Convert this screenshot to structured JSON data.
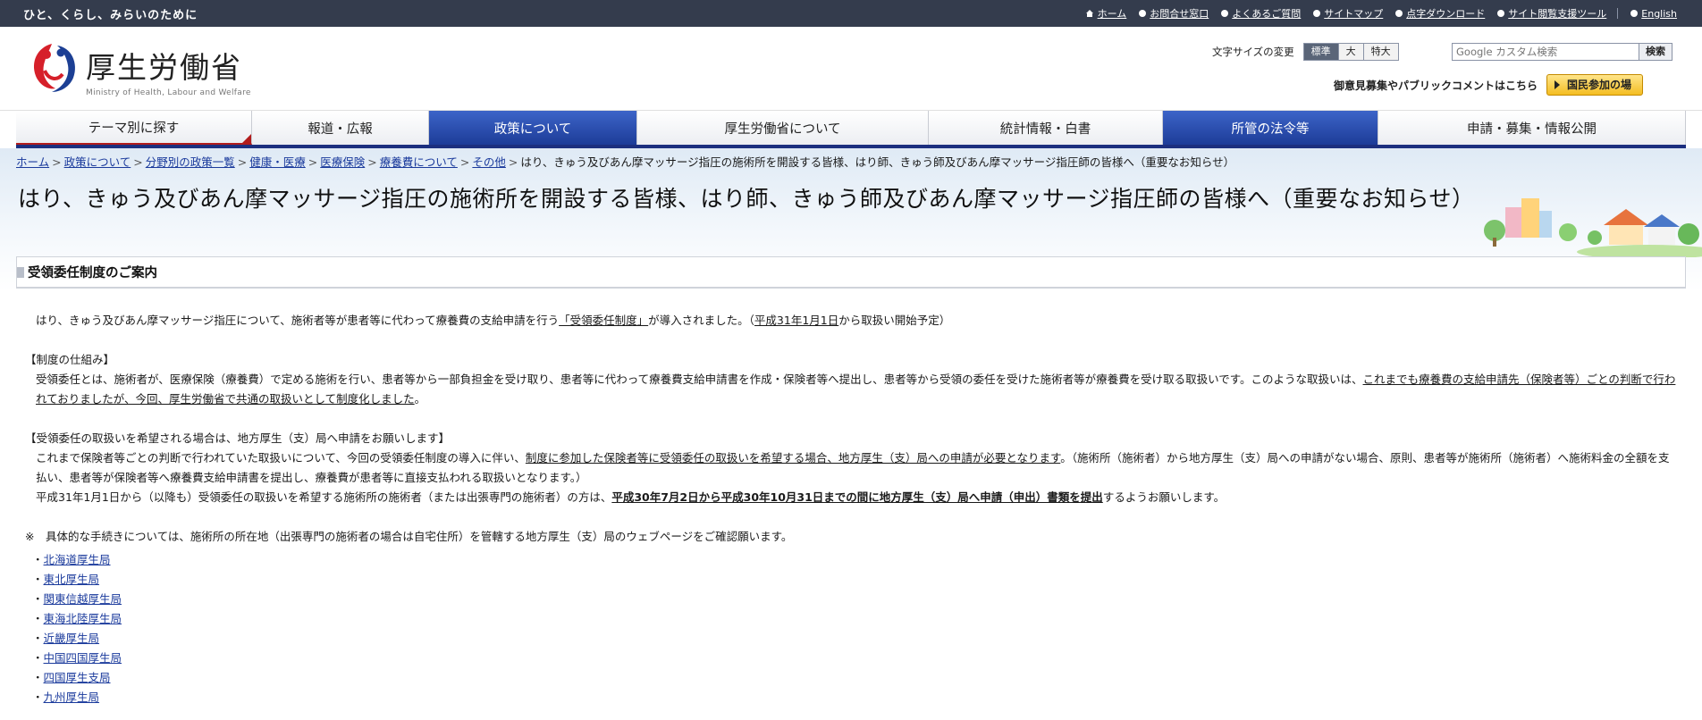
{
  "topbar": {
    "tagline": "ひと、くらし、みらいのために",
    "links": [
      {
        "label": "ホーム",
        "icon": "home-icon"
      },
      {
        "label": "お問合せ窓口",
        "icon": "circle-icon"
      },
      {
        "label": "よくあるご質問",
        "icon": "circle-icon"
      },
      {
        "label": "サイトマップ",
        "icon": "circle-icon"
      },
      {
        "label": "点字ダウンロード",
        "icon": "circle-icon"
      },
      {
        "label": "サイト閲覧支援ツール",
        "icon": "circle-icon"
      },
      {
        "label": "English",
        "icon": "circle-icon"
      }
    ]
  },
  "header": {
    "logo_jp": "厚生労働省",
    "logo_en": "Ministry of Health, Labour and Welfare",
    "fontsize_label": "文字サイズの変更",
    "fontsize_options": [
      "標準",
      "大",
      "特大"
    ],
    "search_placeholder": "Google カスタム検索",
    "search_button": "検索",
    "public_comment": "御意見募集やパブリックコメントはこちら",
    "public_button": "国民参加の場"
  },
  "nav": {
    "items": [
      {
        "label": "テーマ別に探す",
        "active": false
      },
      {
        "label": "報道・広報",
        "active": false
      },
      {
        "label": "政策について",
        "active": true
      },
      {
        "label": "厚生労働省について",
        "active": false
      },
      {
        "label": "統計情報・白書",
        "active": false
      },
      {
        "label": "所管の法令等",
        "active": true
      },
      {
        "label": "申請・募集・情報公開",
        "active": false
      }
    ]
  },
  "breadcrumb": {
    "items": [
      "ホーム",
      "政策について",
      "分野別の政策一覧",
      "健康・医療",
      "医療保険",
      "療養費について",
      "その他"
    ],
    "current": "はり、きゅう及びあん摩マッサージ指圧の施術所を開設する皆様、はり師、きゅう師及びあん摩マッサージ指圧師の皆様へ（重要なお知らせ）"
  },
  "page": {
    "title": "はり、きゅう及びあん摩マッサージ指圧の施術所を開設する皆様、はり師、きゅう師及びあん摩マッサージ指圧師の皆様へ（重要なお知らせ）",
    "section_title": "受領委任制度のご案内"
  },
  "content": {
    "intro_a": "はり、きゅう及びあん摩マッサージ指圧について、施術者等が患者等に代わって療養費の支給申請を行う",
    "intro_link": "「受領委任制度」",
    "intro_b": "が導入されました。（",
    "intro_date": "平成31年1月1日",
    "intro_c": "から取扱い開始予定）",
    "h1": "【制度の仕組み】",
    "s1_a": "受領委任とは、施術者が、医療保険（療養費）で定める施術を行い、患者等から一部負担金を受け取り、患者等に代わって療養費支給申請書を作成・保険者等へ提出し、患者等から受領の委任を受けた施術者等が療養費を受け取る取扱いです。このような取扱いは、",
    "s1_u": "これまでも療養費の支給申請先（保険者等）ごとの判断で行われておりましたが、今回、厚生労働省で共通の取扱いとして制度化しました",
    "s1_b": "。",
    "h2": "【受領委任の取扱いを希望される場合は、地方厚生（支）局へ申請をお願いします】",
    "s2_a": "これまで保険者等ごとの判断で行われていた取扱いについて、今回の受領委任制度の導入に伴い、",
    "s2_u": "制度に参加した保険者等に受領委任の取扱いを希望する場合、地方厚生（支）局への申請が必要となります",
    "s2_b": "。（施術所（施術者）から地方厚生（支）局への申請がない場合、原則、患者等が施術所（施術者）へ施術料金の全額を支払い、患者等が保険者等へ療養費支給申請書を提出し、療養費が患者等に直接支払われる取扱いとなります。）",
    "s3_a": "平成31年1月1日から（以降も）受領委任の取扱いを希望する施術所の施術者（または出張専門の施術者）の方は、",
    "s3_u": "平成30年7月2日から平成30年10月31日までの間に地方厚生（支）局へ申請（申出）書類を提出",
    "s3_b": "するようお願いします。",
    "note": "※　具体的な手続きについては、施術所の所在地（出張専門の施術者の場合は自宅住所）を管轄する地方厚生（支）局のウェブページをご確認願います。",
    "bureaus": [
      "北海道厚生局",
      "東北厚生局",
      "関東信越厚生局",
      "東海北陸厚生局",
      "近畿厚生局",
      "中国四国厚生局",
      "四国厚生支局",
      "九州厚生局"
    ]
  }
}
